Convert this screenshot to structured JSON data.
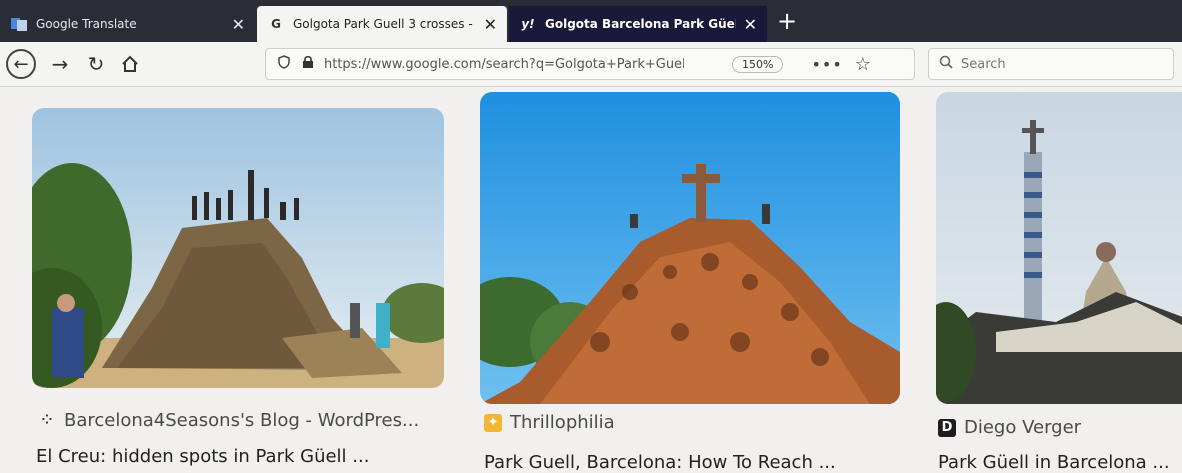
{
  "tabs": [
    {
      "label": "Google Translate",
      "icon": "google-translate-icon",
      "active": false
    },
    {
      "label": "Golgota Park Guell 3 crosses -",
      "icon": "google-g-icon",
      "active": true
    },
    {
      "label": "Golgota Barcelona Park Güell",
      "icon": "yahoo-y-icon",
      "active": false
    }
  ],
  "nav": {
    "url": "https://www.google.com/search?q=Golgota+Park+Guel",
    "zoom": "150%",
    "search_placeholder": "Search"
  },
  "results": [
    {
      "source": "Barcelona4Seasons's Blog - WordPres...",
      "source_icon": "dots-grid-icon",
      "caption": "El Creu: hidden spots in Park Güell ..."
    },
    {
      "source": "Thrillophilia",
      "source_icon": "thrillophilia-icon",
      "caption": "Park Guell, Barcelona: How To Reach ..."
    },
    {
      "source": "Diego Verger",
      "source_icon": "d-logo-icon",
      "caption": "Park Güell in Barcelona ..."
    }
  ]
}
